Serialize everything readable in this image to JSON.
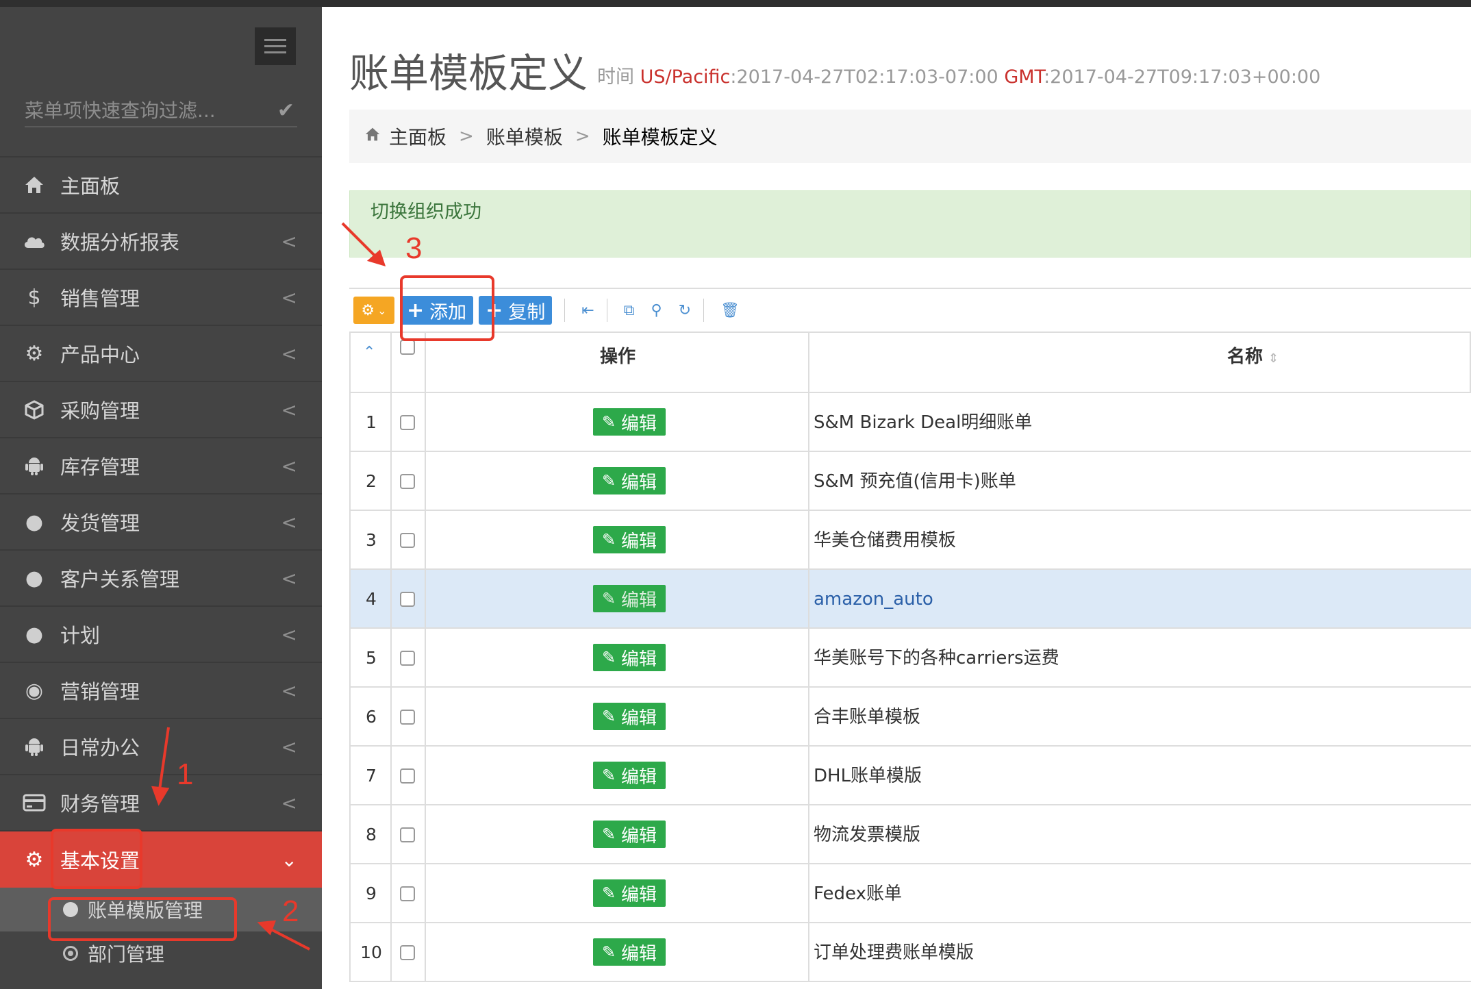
{
  "sidebar": {
    "filter_placeholder": "菜单项快速查询过滤...",
    "items": [
      {
        "label": "主面板",
        "icon": "home-icon"
      },
      {
        "label": "数据分析报表",
        "icon": "cloud-icon"
      },
      {
        "label": "销售管理",
        "icon": "dollar-icon"
      },
      {
        "label": "产品中心",
        "icon": "gears-icon"
      },
      {
        "label": "采购管理",
        "icon": "cube-icon"
      },
      {
        "label": "库存管理",
        "icon": "android-icon"
      },
      {
        "label": "发货管理",
        "icon": "circle-icon"
      },
      {
        "label": "客户关系管理",
        "icon": "circle-icon"
      },
      {
        "label": "计划",
        "icon": "circle-icon"
      },
      {
        "label": "营销管理",
        "icon": "dot-circle-icon"
      },
      {
        "label": "日常办公",
        "icon": "android-icon"
      },
      {
        "label": "财务管理",
        "icon": "credit-card-icon"
      },
      {
        "label": "基本设置",
        "icon": "gears-icon"
      }
    ],
    "sub_items": [
      {
        "label": "账单模版管理"
      },
      {
        "label": "部门管理"
      }
    ]
  },
  "header": {
    "title": "账单模板定义",
    "time_prefix": "时间",
    "tz1": "US/Pacific",
    "time1": ":2017-04-27T02:17:03-07:00",
    "tz2": "GMT",
    "time2": ":2017-04-27T09:17:03+00:00"
  },
  "breadcrumb": [
    "主面板",
    "账单模板",
    "账单模板定义"
  ],
  "alert": "切换组织成功",
  "toolbar": {
    "add_label": "添加",
    "copy_label": "复制"
  },
  "table": {
    "headers": {
      "op": "操作",
      "name": "名称"
    },
    "edit_label": "编辑",
    "rows": [
      {
        "num": "1",
        "name": "S&M Bizark Deal明细账单"
      },
      {
        "num": "2",
        "name": "S&M 预充值(信用卡)账单"
      },
      {
        "num": "3",
        "name": "华美仓储费用模板"
      },
      {
        "num": "4",
        "name": "amazon_auto"
      },
      {
        "num": "5",
        "name": "华美账号下的各种carriers运费"
      },
      {
        "num": "6",
        "name": "合丰账单模板"
      },
      {
        "num": "7",
        "name": "DHL账单模版"
      },
      {
        "num": "8",
        "name": "物流发票模版"
      },
      {
        "num": "9",
        "name": "Fedex账单"
      },
      {
        "num": "10",
        "name": "订单处理费账单模版"
      }
    ]
  },
  "annotations": {
    "n1": "1",
    "n2": "2",
    "n3": "3",
    "color": "#e8392b"
  }
}
